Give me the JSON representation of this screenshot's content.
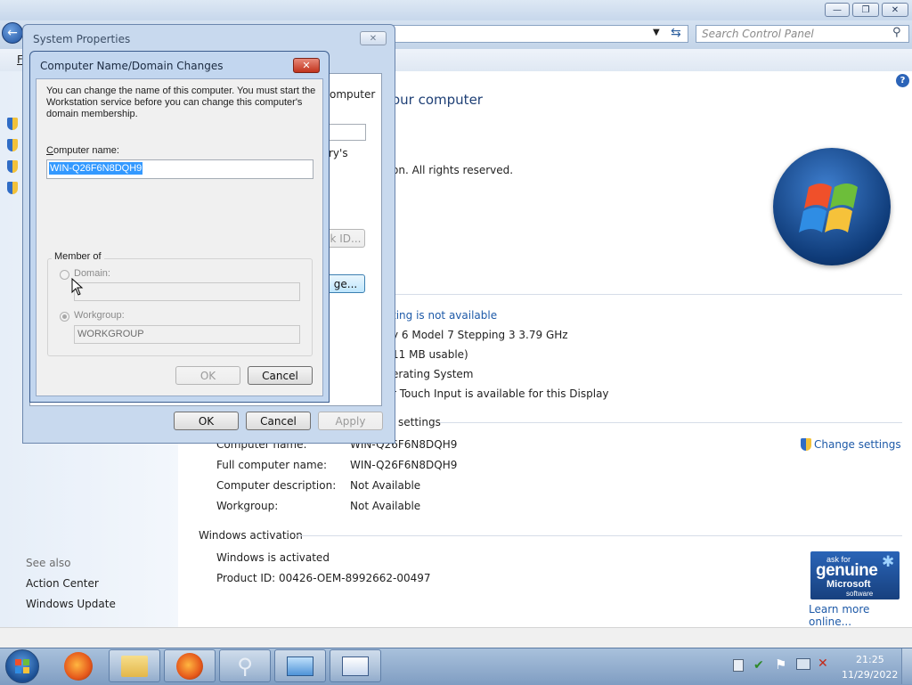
{
  "control_panel": {
    "search_placeholder": "Search Control Panel",
    "menu_initial": "F",
    "heading": "our computer",
    "copyright_fragment": "on.  All rights reserved.",
    "processor_fragment": "y 6 Model 7 Stepping 3   3.79 GHz",
    "memory_fragment": "11 MB usable)",
    "system_type_fragment": "erating System",
    "pen_touch_fragment": "r Touch Input is available for this Display",
    "rating_fragment": "ting is not available",
    "settings_section_fragment": "settings",
    "computer_name_label": "Computer name:",
    "computer_name_value": "WIN-Q26F6N8DQH9",
    "full_computer_name_label": "Full computer name:",
    "full_computer_name_value": "WIN-Q26F6N8DQH9",
    "description_label": "Computer description:",
    "description_value": "Not Available",
    "workgroup_label": "Workgroup:",
    "workgroup_value": "Not Available",
    "change_settings": "Change settings",
    "activation_section": "Windows activation",
    "activation_status": "Windows is activated",
    "product_id": "Product ID: 00426-OEM-8992662-00497",
    "learn_more": "Learn more online...",
    "genuine_badge": {
      "line1": "ask for",
      "line2": "genuine",
      "line3": "Microsoft",
      "line4": "software"
    },
    "see_also": "See also",
    "see_also_items": [
      "Action Center",
      "Windows Update"
    ]
  },
  "system_properties": {
    "title": "System Properties",
    "frag_computer": "omputer",
    "frag_ys": "ry's",
    "frag_network_id": "k ID...",
    "frag_change": "ge...",
    "ok": "OK",
    "cancel": "Cancel",
    "apply": "Apply"
  },
  "name_dialog": {
    "title": "Computer Name/Domain Changes",
    "intro": "You can change the name of this computer.  You must start the Workstation service before you can change this computer's domain membership.",
    "computer_name_label": "Computer name:",
    "computer_name_value": "WIN-Q26F6N8DQH9",
    "member_of": "Member of",
    "domain_label": "Domain:",
    "domain_value": "",
    "workgroup_label": "Workgroup:",
    "workgroup_value": "WORKGROUP",
    "ok": "OK",
    "cancel": "Cancel"
  },
  "taskbar": {
    "time": "21:25",
    "date": "11/29/2022",
    "buttons": [
      "start-orb",
      "firefox",
      "windows-explorer",
      "firefox-window",
      "search-window",
      "control-panel",
      "system-properties"
    ]
  },
  "colors": {
    "link": "#1e5aa8",
    "selection": "#3399ff",
    "title_blue": "#1e3f75"
  }
}
